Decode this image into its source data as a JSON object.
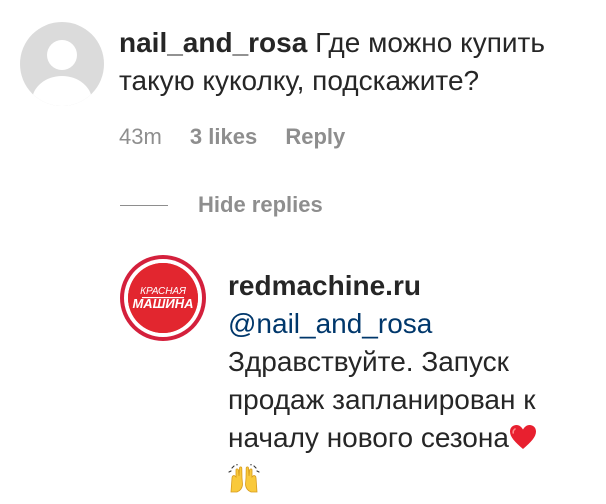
{
  "comment": {
    "username": "nail_and_rosa",
    "text": "Где можно купить такую куколку, подскажите?",
    "time": "43m",
    "likes": "3 likes",
    "reply_label": "Reply"
  },
  "hide_replies_label": "Hide replies",
  "reply": {
    "username": "redmachine.ru",
    "mention": "@nail_and_rosa",
    "text": "Здравствуйте. Запуск продаж запланирован к началу нового сезона",
    "emojis": [
      "red-heart-icon",
      "raising-hands-icon"
    ],
    "logo_text": [
      "КРАСНАЯ",
      "МАШИНА"
    ]
  },
  "colors": {
    "text": "#262626",
    "secondary": "#8e8e8e",
    "mention": "#00376b",
    "brand_red": "#e2262f",
    "avatar_placeholder": "#dbdbdb"
  }
}
